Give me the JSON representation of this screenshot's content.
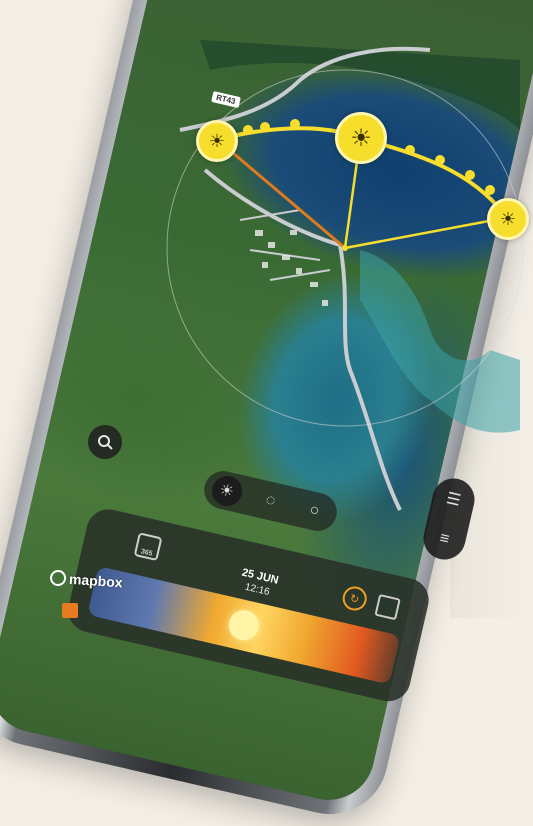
{
  "map": {
    "road_label": "RT43",
    "attribution": "mapbox"
  },
  "markers": {
    "sunrise_icon": "sunrise-icon",
    "sun_icon": "sun-icon",
    "sunset_icon": "sunset-icon"
  },
  "controls": {
    "search_icon": "search-icon",
    "sun_mode_icon": "sun-icon",
    "moon_mode_icon": "moon-phase-icon",
    "other_mode_icon": "circle-icon"
  },
  "time_panel": {
    "calendar_label": "365",
    "date": "25 JUN",
    "time": "12:16"
  },
  "colors": {
    "marker_yellow": "#f7de2c",
    "sunset_line": "#e07a1c",
    "reset_orange": "#f0a020"
  }
}
